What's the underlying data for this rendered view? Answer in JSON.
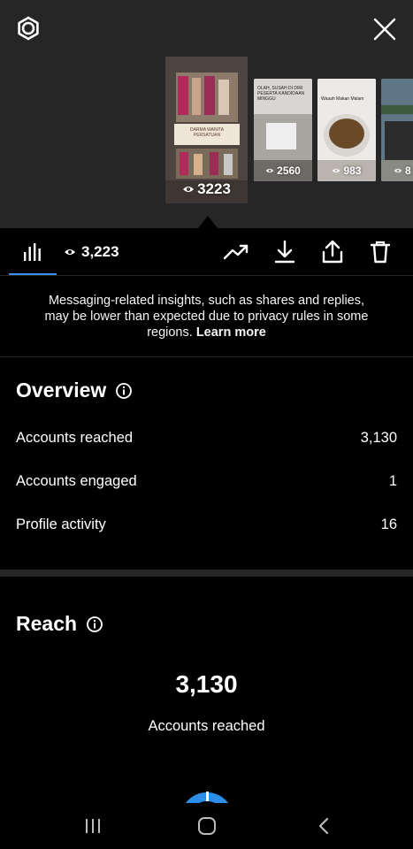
{
  "thumbnails": [
    {
      "views": "3223",
      "caption": "DARMA WANITA PERSATUAN",
      "active": true
    },
    {
      "views": "2560",
      "caption": "OLAH, SUSAH DI DIRI PESERTA KANDIDAAN MINGGU",
      "active": false
    },
    {
      "views": "983",
      "caption": "Waaah Makan Malam",
      "active": false
    },
    {
      "views": "8",
      "caption": "",
      "active": false
    }
  ],
  "tabbar": {
    "view_count": "3,223"
  },
  "notice": {
    "text": "Messaging-related insights, such as shares and replies, may be lower than expected due to privacy rules in some regions.",
    "link": "Learn more"
  },
  "overview": {
    "title": "Overview",
    "rows": [
      {
        "label": "Accounts reached",
        "value": "3,130"
      },
      {
        "label": "Accounts engaged",
        "value": "1"
      },
      {
        "label": "Profile activity",
        "value": "16"
      }
    ]
  },
  "reach": {
    "title": "Reach",
    "number": "3,130",
    "caption": "Accounts reached"
  },
  "icons": {
    "settings": "settings-icon",
    "close": "close-icon",
    "insights": "bar-chart-icon",
    "eye": "eye-icon",
    "promote": "trending-up-icon",
    "download": "download-icon",
    "share": "share-icon",
    "delete": "trash-icon",
    "info": "info-icon"
  },
  "colors": {
    "accent": "#3a8ef0",
    "top_background": "#262626",
    "background": "#000000"
  }
}
